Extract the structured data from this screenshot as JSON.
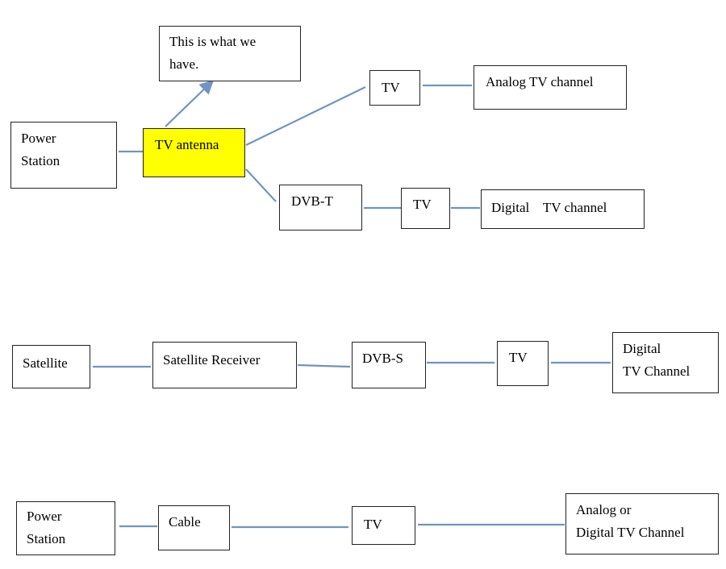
{
  "colors": {
    "connector": "#6f95c0",
    "highlight": "#ffff00",
    "border": "#222222"
  },
  "nodes": {
    "note": "This  is  what  we\nhave.",
    "power_station_1": "Power\nStation",
    "tv_antenna": "TV antenna",
    "tv_1": "TV",
    "analog_channel": "Analog TV channel",
    "dvb_t": "DVB-T",
    "tv_2": "TV",
    "digital_channel_1": "Digital    TV channel",
    "satellite": "Satellite",
    "satellite_receiver": "Satellite Receiver",
    "dvb_s": "DVB-S",
    "tv_3": "TV",
    "digital_channel_2": "Digital\nTV Channel",
    "power_station_3": "Power\nStation",
    "cable": "Cable",
    "tv_4": "TV",
    "analog_or_digital_channel": "Analog or\nDigital TV Channel"
  }
}
